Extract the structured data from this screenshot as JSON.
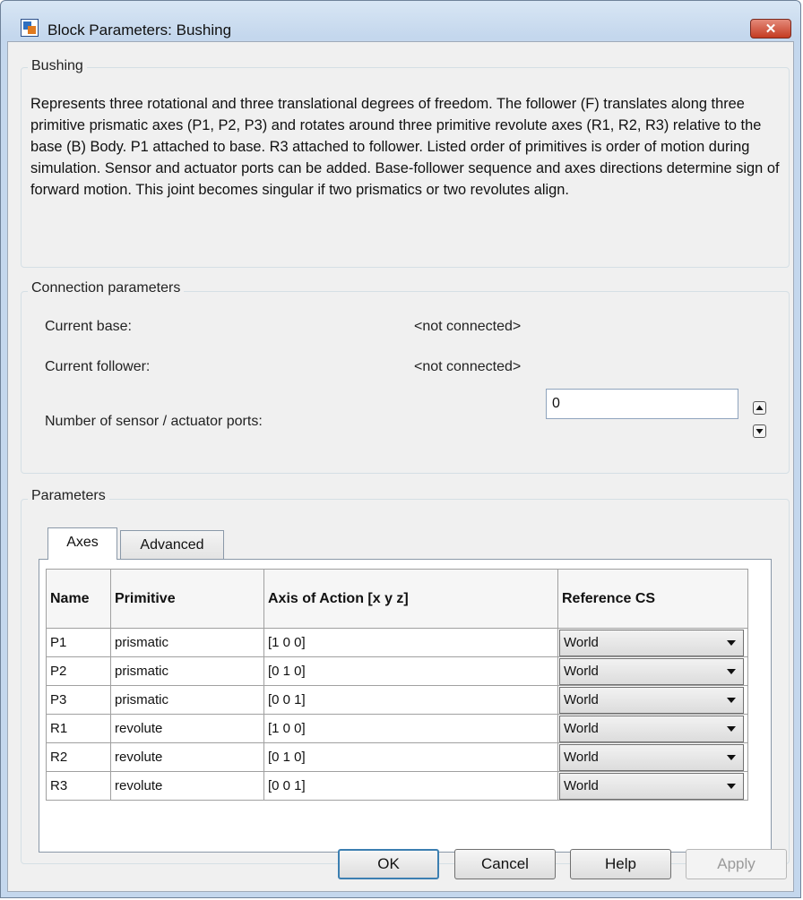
{
  "window": {
    "title": "Block Parameters: Bushing",
    "close_label": "✕"
  },
  "description": {
    "heading": "Bushing",
    "text": "Represents three rotational and three translational degrees of freedom. The follower (F) translates along three primitive prismatic axes (P1, P2, P3) and rotates around three primitive revolute axes (R1, R2, R3) relative to the base (B) Body. P1 attached to base. R3 attached to follower. Listed order of primitives is order of motion during simulation. Sensor and actuator ports can be added. Base-follower sequence and axes directions determine sign of forward motion. This joint becomes singular if two prismatics or two revolutes align."
  },
  "connection": {
    "heading": "Connection parameters",
    "current_base_label": "Current base:",
    "current_base_value": "<not connected>",
    "current_follower_label": "Current follower:",
    "current_follower_value": "<not connected>",
    "ports_label": "Number of sensor / actuator ports:",
    "ports_value": "0"
  },
  "parameters": {
    "heading": "Parameters",
    "tabs": [
      {
        "label": "Axes",
        "active": true
      },
      {
        "label": "Advanced",
        "active": false
      }
    ],
    "columns": [
      "Name",
      "Primitive",
      "Axis of Action [x y z]",
      "Reference CS"
    ],
    "rows": [
      {
        "name": "P1",
        "primitive": "prismatic",
        "axis": "[1 0 0]",
        "ref": "World"
      },
      {
        "name": "P2",
        "primitive": "prismatic",
        "axis": "[0 1 0]",
        "ref": "World"
      },
      {
        "name": "P3",
        "primitive": "prismatic",
        "axis": "[0 0 1]",
        "ref": "World"
      },
      {
        "name": "R1",
        "primitive": "revolute",
        "axis": "[1 0 0]",
        "ref": "World"
      },
      {
        "name": "R2",
        "primitive": "revolute",
        "axis": "[0 1 0]",
        "ref": "World"
      },
      {
        "name": "R3",
        "primitive": "revolute",
        "axis": "[0 0 1]",
        "ref": "World"
      }
    ]
  },
  "buttons": {
    "ok": "OK",
    "cancel": "Cancel",
    "help": "Help",
    "apply": "Apply"
  },
  "colors": {
    "accent": "#3c7fb1",
    "frame": "#c4d7ed",
    "close": "#c43b22"
  }
}
